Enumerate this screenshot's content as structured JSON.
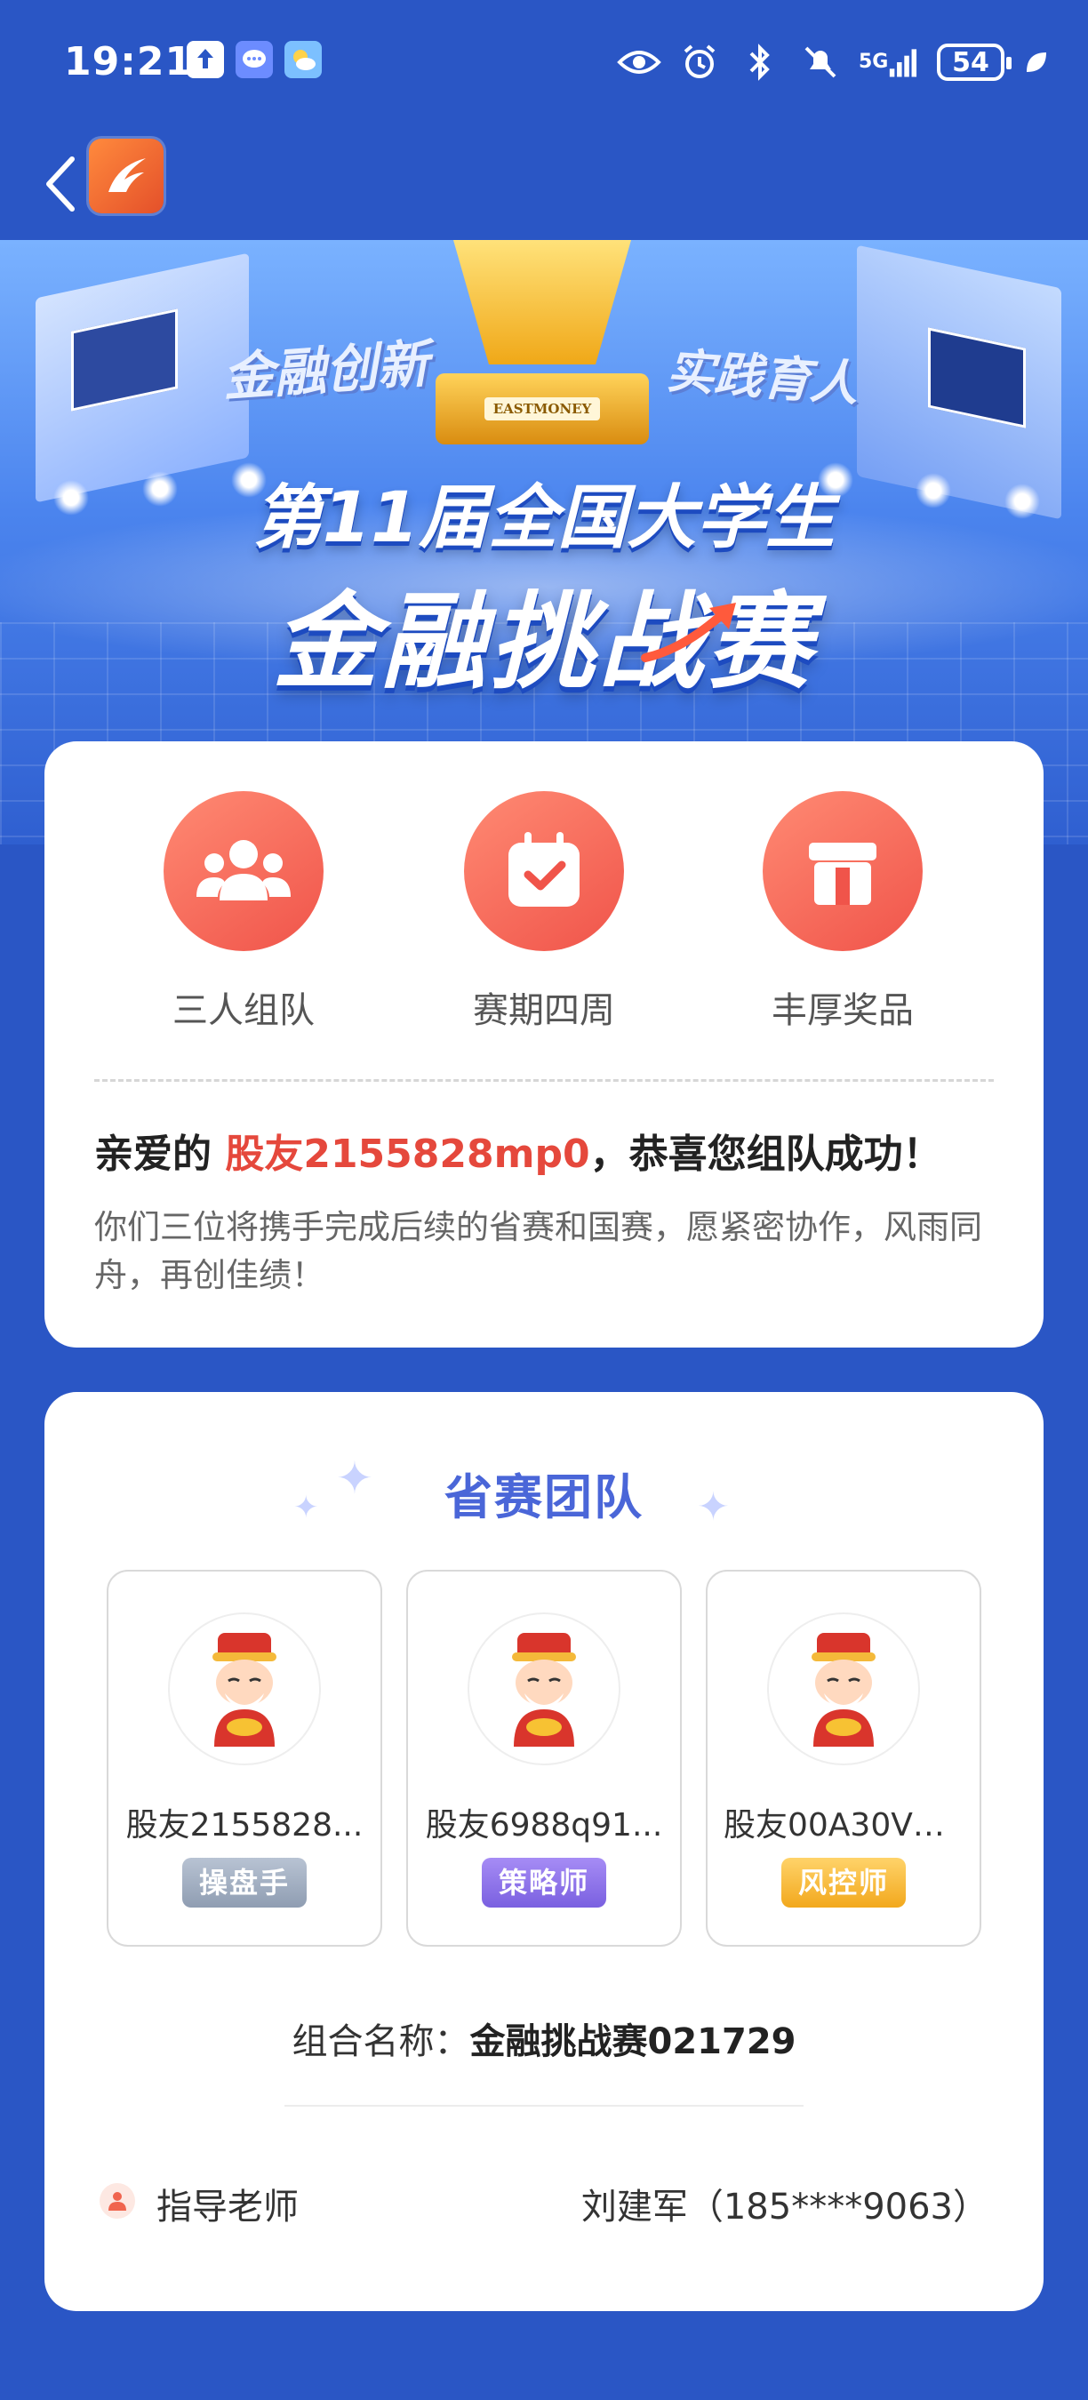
{
  "status_bar": {
    "time": "19:21",
    "battery": "54",
    "network": "5G",
    "icons": [
      "upload-icon",
      "message-icon",
      "weather-icon",
      "eye-icon",
      "alarm-icon",
      "bluetooth-icon",
      "mute-icon",
      "signal-icon",
      "battery-icon",
      "leaf-icon"
    ]
  },
  "nav": {
    "back_icon": "chevron-left-icon",
    "logo_icon": "app-logo-icon"
  },
  "hero": {
    "title_line1": "第11届全国大学生",
    "title_line2": "金融挑战赛",
    "slogan_left": "金融创新",
    "slogan_right": "实践育人",
    "trophy_plate": "EASTMONEY"
  },
  "intro": {
    "features": [
      {
        "label": "三人组队",
        "icon": "team-icon"
      },
      {
        "label": "赛期四周",
        "icon": "calendar-icon"
      },
      {
        "label": "丰厚奖品",
        "icon": "gift-icon"
      }
    ],
    "greeting_prefix": "亲爱的 ",
    "user_name": "股友2155828mp0",
    "greeting_suffix": "，恭喜您组队成功！",
    "message": "你们三位将携手完成后续的省赛和国赛，愿紧密协作，风雨同舟，再创佳绩！"
  },
  "team": {
    "title": "省赛团队",
    "members": [
      {
        "name": "股友2155828...",
        "role": "操盘手"
      },
      {
        "name": "股友6988q91...",
        "role": "策略师"
      },
      {
        "name": "股友00A30V0...",
        "role": "风控师"
      }
    ],
    "combo_label": "组合名称：",
    "combo_value": "金融挑战赛021729",
    "advisor_label": "指导老师",
    "advisor_value": "刘建军（185****9063）"
  },
  "colors": {
    "background": "#2a56c5",
    "accent_red": "#e5483c",
    "title_blue": "#4a66d8",
    "role_trader": "#8f9db2",
    "role_strategist": "#7a60e0",
    "role_risk": "#f2a81d"
  }
}
